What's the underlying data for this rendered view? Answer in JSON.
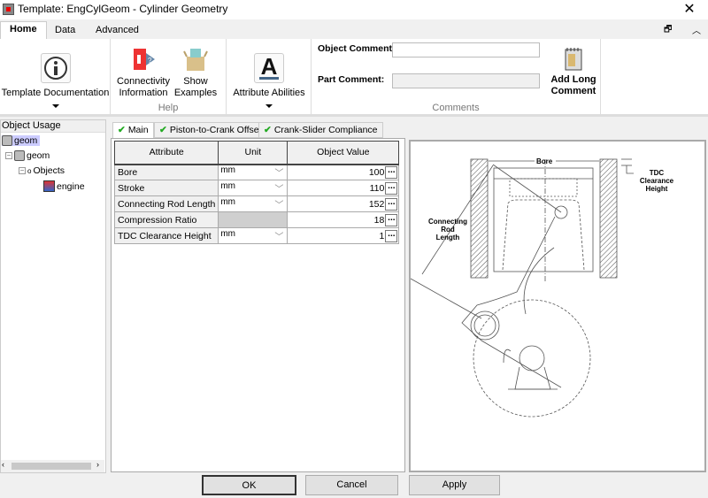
{
  "window": {
    "title": "Template: EngCylGeom - Cylinder Geometry",
    "close": "✕"
  },
  "ribbon_tabs": [
    {
      "label": "Home"
    },
    {
      "label": "Data"
    },
    {
      "label": "Advanced"
    }
  ],
  "window_controls": {
    "restore": "🗗",
    "collapse": "︿"
  },
  "ribbon": {
    "template_documentation": "Template Documentation",
    "connectivity_information": "Connectivity Information",
    "show_examples": "Show Examples",
    "help_group": "Help",
    "attribute_abilities": "Attribute Abilities",
    "object_comment_label": "Object Comment:",
    "object_comment_value": "",
    "part_comment_label": "Part Comment:",
    "part_comment_value": "",
    "add_long_comment": "Add Long Comment",
    "comments_group": "Comments"
  },
  "object_usage": {
    "title": "Object Usage",
    "tree": [
      {
        "label": "geom"
      },
      {
        "label": "geom"
      },
      {
        "label": "Objects"
      },
      {
        "label": "engine"
      }
    ]
  },
  "content_tabs": [
    {
      "label": "Main"
    },
    {
      "label": "Piston-to-Crank Offset"
    },
    {
      "label": "Crank-Slider Compliance"
    }
  ],
  "table": {
    "headers": [
      "Attribute",
      "Unit",
      "Object Value"
    ],
    "rows": [
      {
        "attribute": "Bore",
        "unit": "mm",
        "value": "100"
      },
      {
        "attribute": "Stroke",
        "unit": "mm",
        "value": "110"
      },
      {
        "attribute": "Connecting Rod Length",
        "unit": "mm",
        "value": "152"
      },
      {
        "attribute": "Compression Ratio",
        "unit": "",
        "value": "18"
      },
      {
        "attribute": "TDC Clearance Height",
        "unit": "mm",
        "value": "1"
      }
    ],
    "ellipsis": "..."
  },
  "diagram": {
    "bore": "Bore",
    "tdc1": "TDC",
    "tdc2": "Clearance",
    "tdc3": "Height",
    "rod1": "Connecting",
    "rod2": "Rod",
    "rod3": "Length"
  },
  "buttons": {
    "ok": "OK",
    "cancel": "Cancel",
    "apply": "Apply"
  }
}
